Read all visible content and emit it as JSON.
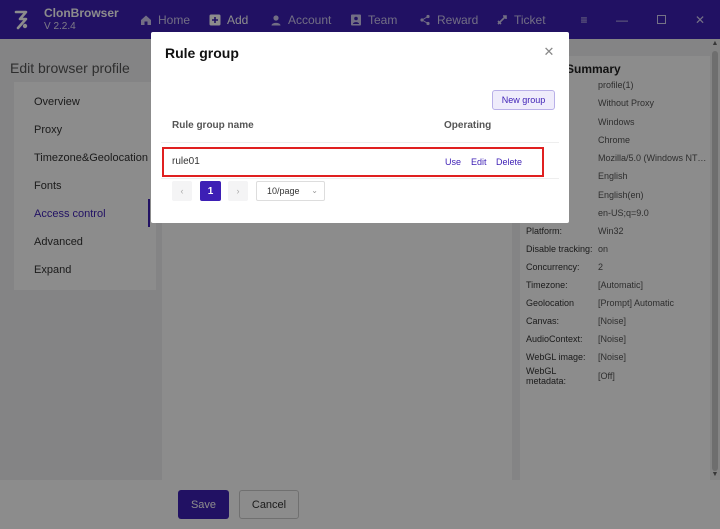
{
  "app": {
    "name": "ClonBrowser",
    "version": "V 2.2.4"
  },
  "nav": [
    {
      "label": "Home",
      "icon": "home-icon"
    },
    {
      "label": "Add",
      "icon": "plus-square-icon"
    },
    {
      "label": "Account",
      "icon": "user-icon"
    },
    {
      "label": "Team",
      "icon": "team-icon"
    },
    {
      "label": "Reward",
      "icon": "share-icon"
    },
    {
      "label": "Ticket",
      "icon": "ticket-icon"
    }
  ],
  "window_controls": [
    "menu-icon",
    "minimize-icon",
    "maximize-icon",
    "close-icon"
  ],
  "page": {
    "title": "Edit browser profile"
  },
  "sidebar": {
    "items": [
      {
        "label": "Overview"
      },
      {
        "label": "Proxy"
      },
      {
        "label": "Timezone&Geolocation"
      },
      {
        "label": "Fonts"
      },
      {
        "label": "Access control"
      },
      {
        "label": "Advanced"
      },
      {
        "label": "Expand"
      }
    ],
    "active": "Access control"
  },
  "summary": {
    "title": "Summary",
    "rows": [
      {
        "key": "",
        "value": "profile(1)"
      },
      {
        "key": "",
        "value": "Without Proxy"
      },
      {
        "key": "",
        "value": "Windows"
      },
      {
        "key": "",
        "value": "Chrome"
      },
      {
        "key": "",
        "value": "Mozilla/5.0 (Windows NT 1..."
      },
      {
        "key": "",
        "value": "English"
      },
      {
        "key": "",
        "value": "English(en)"
      },
      {
        "key": "",
        "value": "en-US;q=9.0"
      },
      {
        "key": "Platform:",
        "value": "Win32"
      },
      {
        "key": "Disable tracking:",
        "value": "on"
      },
      {
        "key": "Concurrency:",
        "value": "2"
      },
      {
        "key": "Timezone:",
        "value": "[Automatic]"
      },
      {
        "key": "Geolocation",
        "value": "[Prompt] Automatic"
      },
      {
        "key": "Canvas:",
        "value": "[Noise]"
      },
      {
        "key": "AudioContext:",
        "value": "[Noise]"
      },
      {
        "key": "WebGL image:",
        "value": "[Noise]"
      },
      {
        "key": "WebGL metadata:",
        "value": "[Off]"
      }
    ]
  },
  "footer": {
    "save": "Save",
    "cancel": "Cancel"
  },
  "modal": {
    "title": "Rule group",
    "new_button": "New group",
    "columns": {
      "name": "Rule group name",
      "operating": "Operating"
    },
    "rows": [
      {
        "name": "rule01",
        "actions": {
          "use": "Use",
          "edit": "Edit",
          "delete": "Delete"
        }
      }
    ],
    "pagination": {
      "current": "1",
      "page_size": "10/page"
    }
  },
  "colors": {
    "accent": "#3d1fb5",
    "highlight": "#e02020"
  }
}
